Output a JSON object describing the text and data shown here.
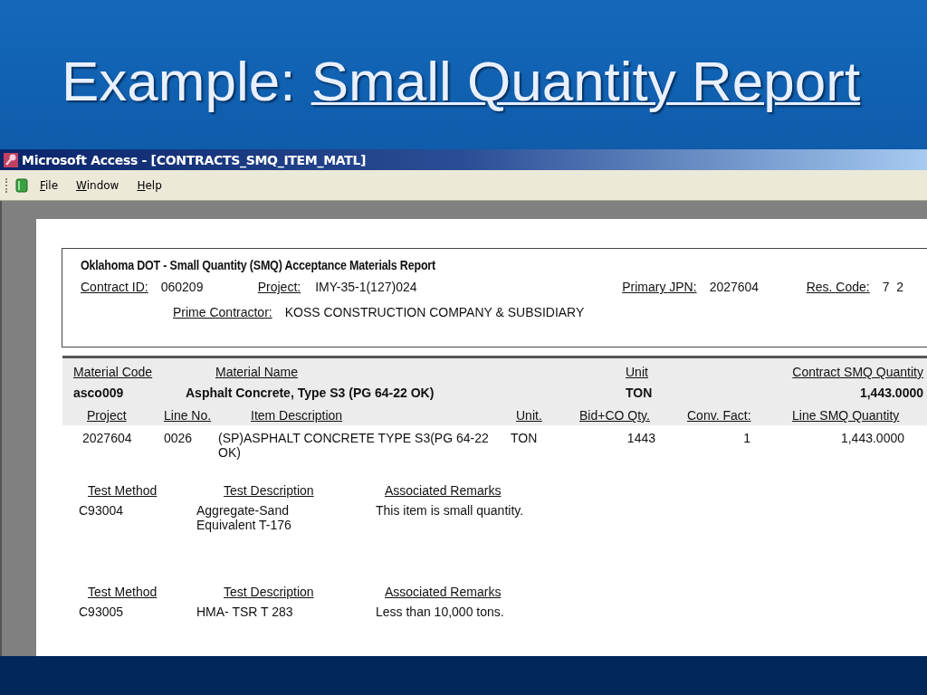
{
  "slide_title": {
    "prefix": "Example:",
    "link": "Small Quantity Report"
  },
  "window": {
    "title": "Microsoft Access - [CONTRACTS_SMQ_ITEM_MATL]"
  },
  "menu": [
    "File",
    "Window",
    "Help"
  ],
  "report": {
    "title": "Oklahoma DOT -  Small Quantity (SMQ) Acceptance Materials Report",
    "fields": [
      {
        "label": "Contract ID:",
        "value": "060209"
      },
      {
        "label": "Project:",
        "value": "IMY-35-1(127)024"
      },
      {
        "label": "Primary JPN:",
        "value": "2027604"
      },
      {
        "label": "Res. Code:",
        "value": "7  2"
      }
    ],
    "prime_contractor": {
      "label": "Prime Contractor:",
      "value": "KOSS CONSTRUCTION COMPANY & SUBSIDIARY"
    }
  },
  "material": {
    "columns": [
      "Material Code",
      "Material Name",
      "Unit",
      "Contract SMQ Quantity"
    ],
    "values": [
      "asco009",
      "Asphalt Concrete, Type S3 (PG 64-22 OK)",
      "TON",
      "1,443.0000"
    ]
  },
  "lines": {
    "columns": [
      "Project",
      "Line No.",
      "Item Description",
      "Unit.",
      "Bid+CO Qty.",
      "Conv. Fact:",
      "Line SMQ Quantity"
    ],
    "rows": [
      [
        "2027604",
        "0026",
        "(SP)ASPHALT CONCRETE TYPE S3(PG 64-22 OK)",
        "TON",
        "1443",
        "1",
        "1,443.0000"
      ]
    ]
  },
  "tests": [
    {
      "columns": [
        "Test Method",
        "Test Description",
        "Associated Remarks"
      ],
      "values": [
        "C93004",
        "Aggregate-Sand Equivalent T-176",
        "This item is small quantity."
      ]
    },
    {
      "columns": [
        "Test Method",
        "Test Description",
        "Associated Remarks"
      ],
      "values": [
        "C93005",
        "HMA- TSR T 283",
        "Less than 10,000 tons."
      ]
    }
  ]
}
